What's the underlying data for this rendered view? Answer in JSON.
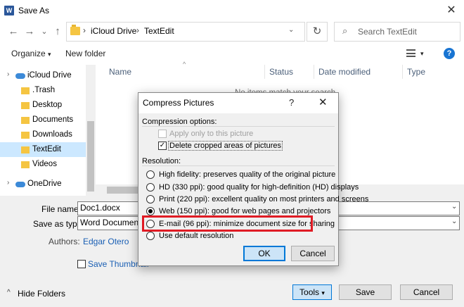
{
  "window": {
    "title": "Save As",
    "app_icon": "W",
    "close_glyph": "✕"
  },
  "nav": {
    "back": "←",
    "forward": "→",
    "recent": "⌄",
    "up": "↑",
    "breadcrumbs": [
      "iCloud Drive",
      "TextEdit"
    ],
    "sep": "›",
    "dropdown": "⌄",
    "refresh": "↻",
    "search_placeholder": "Search TextEdit",
    "search_icon": "⌕"
  },
  "toolbar": {
    "organize": "Organize",
    "new_folder": "New folder",
    "help": "?",
    "caret": "▾"
  },
  "sidebar": {
    "items": [
      {
        "label": "iCloud Drive",
        "icon": "cloud-icon"
      },
      {
        "label": ".Trash",
        "icon": "folder-icon"
      },
      {
        "label": "Desktop",
        "icon": "folder-icon"
      },
      {
        "label": "Documents",
        "icon": "folder-icon"
      },
      {
        "label": "Downloads",
        "icon": "folder-icon"
      },
      {
        "label": "TextEdit",
        "icon": "folder-icon"
      },
      {
        "label": "Videos",
        "icon": "folder-icon"
      },
      {
        "label": "OneDrive",
        "icon": "cloud-icon"
      }
    ],
    "expand": "›"
  },
  "columns": {
    "name": "Name",
    "status": "Status",
    "date": "Date modified",
    "type": "Type",
    "empty": "No items match your search."
  },
  "form": {
    "file_name_label": "File name:",
    "file_name_value": "Doc1.docx",
    "save_type_label": "Save as type:",
    "save_type_value": "Word Document (",
    "authors_label": "Authors:",
    "authors_value": "Edgar Otero",
    "save_thumbnail": "Save Thumbnail",
    "hide_folders": "Hide Folders",
    "caret_down": "⌄",
    "hide_caret": "^"
  },
  "buttons": {
    "tools": "Tools",
    "save": "Save",
    "cancel": "Cancel"
  },
  "modal": {
    "title": "Compress Pictures",
    "help": "?",
    "close": "✕",
    "compression_header": "Compression options:",
    "apply_only": "Apply only to this picture",
    "delete_cropped": "Delete cropped areas of pictures",
    "resolution_header": "Resolution:",
    "options": [
      "High fidelity: preserves quality of the original picture",
      "HD (330 ppi): good quality for high-definition (HD) displays",
      "Print (220 ppi): excellent quality on most printers and screens",
      "Web (150 ppi): good for web pages and projectors",
      "E-mail (96 ppi): minimize document size for sharing",
      "Use default resolution"
    ],
    "selected_index": 3,
    "ok": "OK",
    "cancel": "Cancel"
  },
  "colors": {
    "accent": "#0078d7",
    "highlight": "#e01b24",
    "selection": "#cce8ff"
  }
}
